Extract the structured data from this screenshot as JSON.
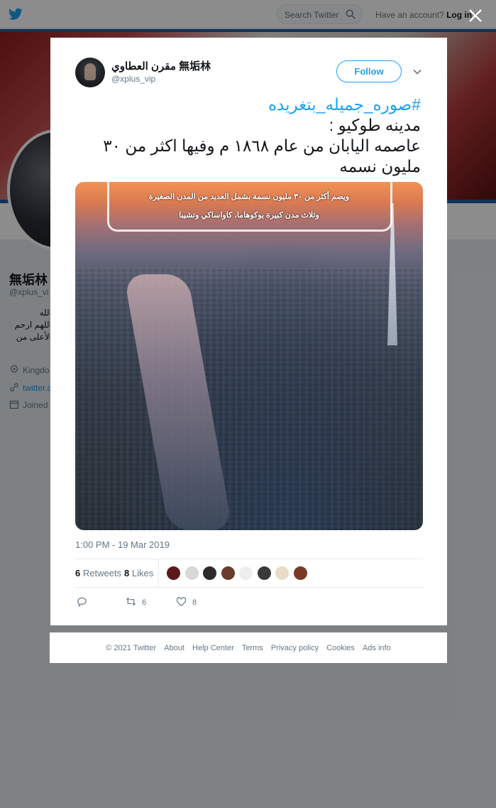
{
  "header": {
    "search_placeholder": "Search Twitter",
    "have_account": "Have an account?",
    "login": "Log in"
  },
  "profile": {
    "name": "無垢林",
    "handle": "@xplus_vi",
    "bio_lines": [
      "الله",
      "اللهم ارحم",
      "الأعلى من"
    ],
    "location": "Kingdo",
    "website": "twitter.c",
    "joined": "Joined"
  },
  "tweet": {
    "author_name": "مقرن العطاوي 無垢林",
    "author_handle": "@xplus_vip",
    "follow_label": "Follow",
    "hashtag": "#صوره_جميله_بتغريده",
    "lines": [
      "مدينه طوكيو :",
      "عاصمه اليابان من عام ١٨٦٨ م وفيها اكثر من ٣٠",
      "مليون نسمه"
    ],
    "image_caption_1": "ويضم أكثر من ٣٠ مليون نسمة بشمل العديد من المدن الصغيرة",
    "image_caption_2": "وثلاث مدن كبيرة يوكوهاما، كاواساكي وتشيبا",
    "timestamp": "1:00 PM - 19 Mar 2019",
    "retweets_count": "6",
    "retweets_label": "Retweets",
    "likes_count": "8",
    "likes_label": "Likes",
    "action_retweets": "6",
    "action_likes": "8",
    "liker_colors": [
      "#5a1a1a",
      "#d8d8d8",
      "#2b2b2b",
      "#6b3b2b",
      "#eeeeee",
      "#3a3a3a",
      "#e8dcc8",
      "#7a3a2a"
    ]
  },
  "footer": {
    "copyright": "© 2021 Twitter",
    "links": [
      "About",
      "Help Center",
      "Terms",
      "Privacy policy",
      "Cookies",
      "Ads info"
    ]
  },
  "colors": {
    "accent": "#1da1f2",
    "text_secondary": "#657786"
  }
}
